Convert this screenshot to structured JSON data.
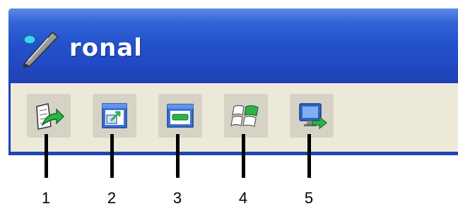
{
  "window": {
    "title": "ronal",
    "title_icon": "pen-icon",
    "colors": {
      "titlebar": "#2453cc",
      "toolbar": "#ece9d8",
      "button_bg": "#d6d3c6"
    }
  },
  "toolbar": {
    "buttons": [
      {
        "icon": "open-document-arrow-icon"
      },
      {
        "icon": "window-arrow-out-icon"
      },
      {
        "icon": "minimize-window-icon"
      },
      {
        "icon": "windows-logo-icon"
      },
      {
        "icon": "monitor-arrow-icon"
      }
    ]
  },
  "callouts": [
    "1",
    "2",
    "3",
    "4",
    "5"
  ]
}
